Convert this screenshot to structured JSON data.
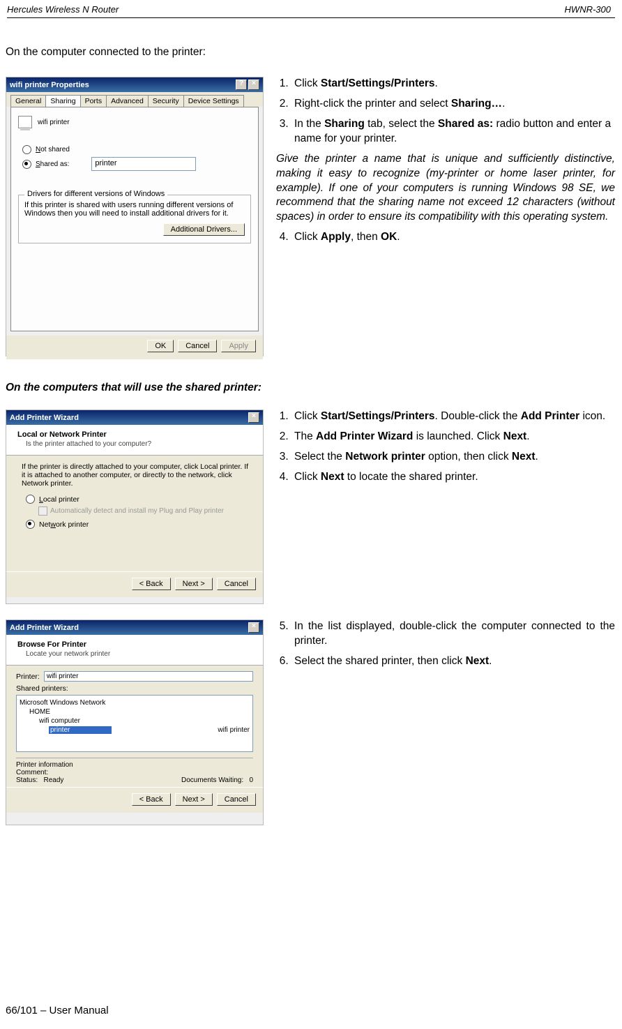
{
  "header": {
    "left": "Hercules Wireless N Router",
    "right": "HWNR-300"
  },
  "footer": "66/101 – User Manual",
  "section1": {
    "title": "On the computer connected to the printer:",
    "dialog": {
      "title": "wifi printer Properties",
      "tabs": {
        "t0": "General",
        "t1": "Sharing",
        "t2": "Ports",
        "t3": "Advanced",
        "t4": "Security",
        "t5": "Device Settings"
      },
      "active_tab": "Sharing",
      "printer_name": "wifi printer",
      "radio_not_shared": "Not shared",
      "radio_shared_as": "Shared as:",
      "shared_as_value": "printer",
      "group_title": "Drivers for different versions of Windows",
      "group_text": "If this printer is shared with users running different versions of Windows then you will need to install additional drivers for it.",
      "btn_additional": "Additional Drivers...",
      "btn_ok": "OK",
      "btn_cancel": "Cancel",
      "btn_apply": "Apply",
      "help_q": "?",
      "close_x": "×"
    },
    "steps": {
      "s1a": "Click ",
      "s1b": "Start/Settings/Printers",
      "s1c": ".",
      "s2a": "Right-click the printer and select ",
      "s2b": "Sharing…",
      "s2c": ".",
      "s3a": "In the ",
      "s3b": "Sharing",
      "s3c": " tab, select the ",
      "s3d": "Shared as:",
      "s3e": " radio button and enter a name for your printer.",
      "note": "Give the printer a name that is unique and sufficiently distinctive, making it easy to recognize (my-printer or home laser printer, for example).  If one of your computers is running Windows 98 SE, we recommend that the sharing name not exceed 12 characters (without spaces) in order to ensure its compatibility with this operating system.",
      "s4a": "Click ",
      "s4b": "Apply",
      "s4c": ", then ",
      "s4d": "OK",
      "s4e": "."
    }
  },
  "section2": {
    "title": "On the computers that will use the shared printer:",
    "wiz1": {
      "title": "Add Printer Wizard",
      "head": "Local or Network Printer",
      "sub": "Is the printer attached to your computer?",
      "body_line": "If the printer is directly attached to your computer, click Local printer.  If it is attached to another computer, or directly to the network, click Network printer.",
      "opt_local": "Local printer",
      "opt_local_sub": "Automatically detect and install my Plug and Play printer",
      "opt_network": "Network printer",
      "btn_back": "< Back",
      "btn_next": "Next >",
      "btn_cancel": "Cancel",
      "close_x": "×"
    },
    "stepsA": {
      "s1a": "Click ",
      "s1b": "Start/Settings/Printers",
      "s1c": ". Double-click the ",
      "s1d": "Add Printer",
      "s1e": " icon.",
      "s2a": "The ",
      "s2b": "Add Printer Wizard",
      "s2c": " is launched.  Click ",
      "s2d": "Next",
      "s2e": ".",
      "s3a": "Select the ",
      "s3b": "Network printer",
      "s3c": " option, then click ",
      "s3d": "Next",
      "s3e": ".",
      "s4a": "Click ",
      "s4b": "Next",
      "s4c": " to locate the shared printer."
    },
    "wiz2": {
      "title": "Add Printer Wizard",
      "head": "Browse For Printer",
      "sub": "Locate your network printer",
      "printer_label": "Printer:",
      "printer_value": "wifi printer",
      "shared_label": "Shared printers:",
      "tree_root": "Microsoft Windows Network",
      "tree_l2": "HOME",
      "tree_l3": "wifi computer",
      "tree_sel": "printer",
      "tree_sel_right": "wifi printer",
      "info_title": "Printer information",
      "comment": "Comment:",
      "status_label": "Status:",
      "status_val": "Ready",
      "docs_label": "Documents Waiting:",
      "docs_val": "0",
      "btn_back": "< Back",
      "btn_next": "Next >",
      "btn_cancel": "Cancel",
      "close_x": "×"
    },
    "stepsB": {
      "s5": "In the list displayed, double-click the computer connected to the printer.",
      "s6a": "Select the shared printer, then click ",
      "s6b": "Next",
      "s6c": "."
    }
  }
}
